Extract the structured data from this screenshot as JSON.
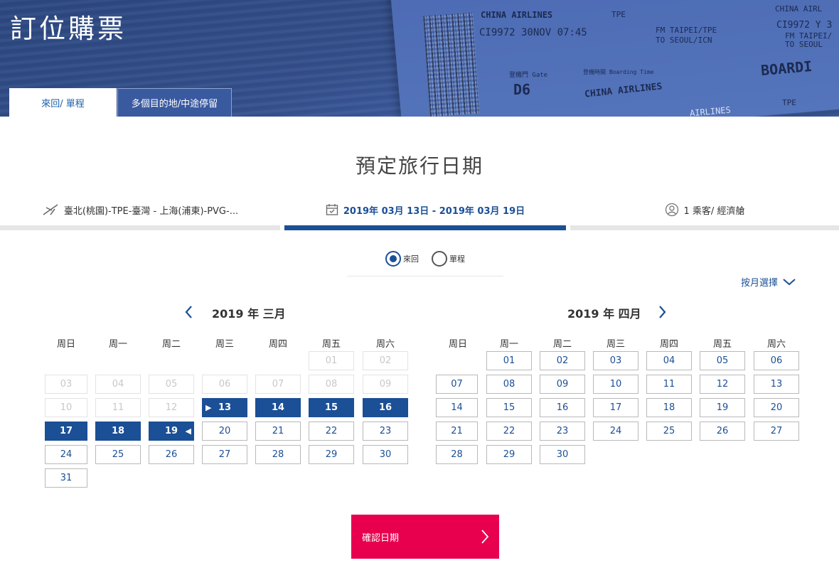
{
  "header": {
    "title": "訂位購票",
    "tabs": [
      {
        "label": "來回/ 單程",
        "active": true
      },
      {
        "label": "多個目的地/中途停留",
        "active": false
      }
    ],
    "ticket": {
      "airline": "CHINA AIRLINES",
      "origin_code": "TPE",
      "flight_line": "CI9972 30NOV 07:45",
      "from_line": "FM TAIPEI/TPE",
      "to_line": "TO SEOUL/ICN",
      "gate_label": "登機門 Gate",
      "gate": "D6",
      "boarding_label": "登機時間 Boarding Time",
      "airline_logo": "CHINA AIRLINES",
      "boarding": "BOARDI",
      "right_airline": "CHINA AIRL",
      "right_flight": "CI9972 Y 3",
      "right_from": "FM TAIPEI/",
      "right_to": "TO SEOUL",
      "right_code": "TPE",
      "footer_airline": "AIRLINES"
    }
  },
  "section_title": "預定旅行日期",
  "steps": {
    "route": "臺北(桃園)-TPE-臺灣 - 上海(浦東)-PVG-...",
    "dates": "2019年 03月 13日 - 2019年 03月 19日",
    "passengers": "1 乘客/ 經濟艙"
  },
  "trip_type": {
    "options": [
      {
        "label": "來回",
        "selected": true
      },
      {
        "label": "單程",
        "selected": false
      }
    ]
  },
  "month_select_label": "按月選擇",
  "weekdays": [
    "周日",
    "周一",
    "周二",
    "周三",
    "周四",
    "周五",
    "周六"
  ],
  "calendars": [
    {
      "title": "2019 年 三月",
      "days": [
        {
          "d": "01",
          "row": 0,
          "col": 5,
          "state": "past"
        },
        {
          "d": "02",
          "row": 0,
          "col": 6,
          "state": "past"
        },
        {
          "d": "03",
          "row": 1,
          "col": 0,
          "state": "past"
        },
        {
          "d": "04",
          "row": 1,
          "col": 1,
          "state": "past"
        },
        {
          "d": "05",
          "row": 1,
          "col": 2,
          "state": "past"
        },
        {
          "d": "06",
          "row": 1,
          "col": 3,
          "state": "past"
        },
        {
          "d": "07",
          "row": 1,
          "col": 4,
          "state": "past"
        },
        {
          "d": "08",
          "row": 1,
          "col": 5,
          "state": "past"
        },
        {
          "d": "09",
          "row": 1,
          "col": 6,
          "state": "past"
        },
        {
          "d": "10",
          "row": 2,
          "col": 0,
          "state": "past"
        },
        {
          "d": "11",
          "row": 2,
          "col": 1,
          "state": "past"
        },
        {
          "d": "12",
          "row": 2,
          "col": 2,
          "state": "past"
        },
        {
          "d": "13",
          "row": 2,
          "col": 3,
          "state": "start"
        },
        {
          "d": "14",
          "row": 2,
          "col": 4,
          "state": "selected"
        },
        {
          "d": "15",
          "row": 2,
          "col": 5,
          "state": "selected"
        },
        {
          "d": "16",
          "row": 2,
          "col": 6,
          "state": "selected"
        },
        {
          "d": "17",
          "row": 3,
          "col": 0,
          "state": "selected"
        },
        {
          "d": "18",
          "row": 3,
          "col": 1,
          "state": "selected"
        },
        {
          "d": "19",
          "row": 3,
          "col": 2,
          "state": "end"
        },
        {
          "d": "20",
          "row": 3,
          "col": 3,
          "state": "available"
        },
        {
          "d": "21",
          "row": 3,
          "col": 4,
          "state": "available"
        },
        {
          "d": "22",
          "row": 3,
          "col": 5,
          "state": "available"
        },
        {
          "d": "23",
          "row": 3,
          "col": 6,
          "state": "available"
        },
        {
          "d": "24",
          "row": 4,
          "col": 0,
          "state": "available"
        },
        {
          "d": "25",
          "row": 4,
          "col": 1,
          "state": "available"
        },
        {
          "d": "26",
          "row": 4,
          "col": 2,
          "state": "available"
        },
        {
          "d": "27",
          "row": 4,
          "col": 3,
          "state": "available"
        },
        {
          "d": "28",
          "row": 4,
          "col": 4,
          "state": "available"
        },
        {
          "d": "29",
          "row": 4,
          "col": 5,
          "state": "available"
        },
        {
          "d": "30",
          "row": 4,
          "col": 6,
          "state": "available"
        },
        {
          "d": "31",
          "row": 5,
          "col": 0,
          "state": "available"
        }
      ]
    },
    {
      "title": "2019 年 四月",
      "days": [
        {
          "d": "01",
          "row": 0,
          "col": 1,
          "state": "available"
        },
        {
          "d": "02",
          "row": 0,
          "col": 2,
          "state": "available"
        },
        {
          "d": "03",
          "row": 0,
          "col": 3,
          "state": "available"
        },
        {
          "d": "04",
          "row": 0,
          "col": 4,
          "state": "available"
        },
        {
          "d": "05",
          "row": 0,
          "col": 5,
          "state": "available"
        },
        {
          "d": "06",
          "row": 0,
          "col": 6,
          "state": "available"
        },
        {
          "d": "07",
          "row": 1,
          "col": 0,
          "state": "available"
        },
        {
          "d": "08",
          "row": 1,
          "col": 1,
          "state": "available"
        },
        {
          "d": "09",
          "row": 1,
          "col": 2,
          "state": "available"
        },
        {
          "d": "10",
          "row": 1,
          "col": 3,
          "state": "available"
        },
        {
          "d": "11",
          "row": 1,
          "col": 4,
          "state": "available"
        },
        {
          "d": "12",
          "row": 1,
          "col": 5,
          "state": "available"
        },
        {
          "d": "13",
          "row": 1,
          "col": 6,
          "state": "available"
        },
        {
          "d": "14",
          "row": 2,
          "col": 0,
          "state": "available"
        },
        {
          "d": "15",
          "row": 2,
          "col": 1,
          "state": "available"
        },
        {
          "d": "16",
          "row": 2,
          "col": 2,
          "state": "available"
        },
        {
          "d": "17",
          "row": 2,
          "col": 3,
          "state": "available"
        },
        {
          "d": "18",
          "row": 2,
          "col": 4,
          "state": "available"
        },
        {
          "d": "19",
          "row": 2,
          "col": 5,
          "state": "available"
        },
        {
          "d": "20",
          "row": 2,
          "col": 6,
          "state": "available"
        },
        {
          "d": "21",
          "row": 3,
          "col": 0,
          "state": "available"
        },
        {
          "d": "22",
          "row": 3,
          "col": 1,
          "state": "available"
        },
        {
          "d": "23",
          "row": 3,
          "col": 2,
          "state": "available"
        },
        {
          "d": "24",
          "row": 3,
          "col": 3,
          "state": "available"
        },
        {
          "d": "25",
          "row": 3,
          "col": 4,
          "state": "available"
        },
        {
          "d": "26",
          "row": 3,
          "col": 5,
          "state": "available"
        },
        {
          "d": "27",
          "row": 3,
          "col": 6,
          "state": "available"
        },
        {
          "d": "28",
          "row": 4,
          "col": 0,
          "state": "available"
        },
        {
          "d": "29",
          "row": 4,
          "col": 1,
          "state": "available"
        },
        {
          "d": "30",
          "row": 4,
          "col": 2,
          "state": "available"
        }
      ]
    }
  ],
  "confirm_label": "確認日期",
  "colors": {
    "primary": "#1b4f96",
    "accent": "#e8004f",
    "banner": "#344f8c"
  },
  "icons": {
    "route": "plane-icon",
    "dates": "calendar-icon",
    "passengers": "user-icon",
    "prev": "chevron-left-icon",
    "next": "chevron-right-icon",
    "month_select": "chevron-down-icon",
    "confirm": "chevron-right-icon"
  }
}
